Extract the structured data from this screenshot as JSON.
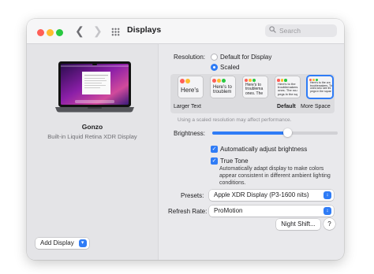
{
  "window": {
    "title": "Displays"
  },
  "search": {
    "placeholder": "Search"
  },
  "display": {
    "name": "Gonzo",
    "subtitle": "Built-in Liquid Retina XDR Display"
  },
  "add_display": {
    "label": "Add Display"
  },
  "resolution": {
    "label": "Resolution:",
    "options": [
      {
        "label": "Default for Display",
        "selected": false
      },
      {
        "label": "Scaled",
        "selected": true
      }
    ],
    "scaled_choices": [
      {
        "label": "Larger Text",
        "thumb": "Here's",
        "bold": false,
        "selected": false
      },
      {
        "label": "",
        "thumb": "Here's to\ntroublem",
        "bold": false,
        "selected": false
      },
      {
        "label": "",
        "thumb": "Here's to\ntroublema\nones. The",
        "bold": false,
        "selected": false
      },
      {
        "label": "Default",
        "thumb": "Here's to the\ntroublemakers\nones. The rou\npegs in the sq",
        "bold": true,
        "selected": false
      },
      {
        "label": "More Space",
        "thumb": "Here's to the cra\ntroublemakers. Th\nones who see thi\npegs in the squar",
        "bold": false,
        "selected": true
      }
    ],
    "note": "Using a scaled resolution may affect performance."
  },
  "brightness": {
    "label": "Brightness:",
    "value": 0.6
  },
  "auto_brightness": {
    "label": "Automatically adjust brightness",
    "checked": true
  },
  "true_tone": {
    "label": "True Tone",
    "checked": true,
    "description": "Automatically adapt display to make colors appear consistent in different ambient lighting conditions."
  },
  "presets": {
    "label": "Presets:",
    "value": "Apple XDR Display (P3-1600 nits)"
  },
  "refresh_rate": {
    "label": "Refresh Rate:",
    "value": "ProMotion"
  },
  "night_shift": {
    "label": "Night Shift..."
  },
  "help": {
    "label": "?"
  },
  "colors": {
    "accent": "#2f7cf6",
    "red": "#ff5f57",
    "yellow": "#febc2e",
    "green": "#28c840"
  },
  "icons": [
    "back-chevron-icon",
    "forward-chevron-icon",
    "grid-icon",
    "search-icon",
    "macbook-icon",
    "chevron-down-icon",
    "checkmark-icon",
    "help-icon"
  ]
}
